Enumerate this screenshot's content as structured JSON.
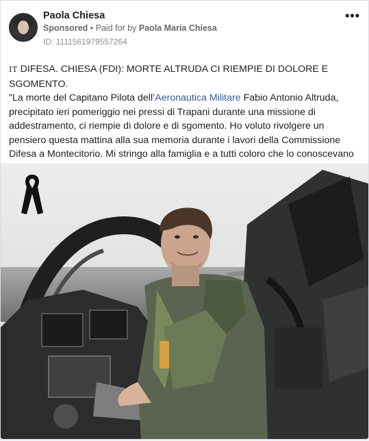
{
  "post": {
    "author": "Paola Chiesa",
    "sponsored_label": "Sponsored",
    "paid_for_prefix": "Paid for by",
    "payer": "Paola Maria Chiesa",
    "ad_id": "ID: 1111561979557264",
    "more_menu": "•••"
  },
  "content": {
    "flag": "IT",
    "headline": "DIFESA. CHIESA (FDI): MORTE ALTRUDA CI RIEMPIE DI DOLORE E SGOMENTO.",
    "body_before_link": "\"La morte del Capitano Pilota dell’",
    "link_text": "Aeronautica Militare",
    "body_after_link": " Fabio Antonio Altruda, precipitato ieri pomeriggio nei pressi di Trapani durante una missione di addestramento, ci riempie di dolore e di sgomento. Ho voluto rivolgere un pensiero questa mattina alla sua memoria durante i lavori della Commissione Difesa a Montecitorio. Mi stringo alla famiglia e a tutti coloro che lo conoscevano e oggi lo piangono. Cieli blu!”. Lo ha detto il capogruppo di Fratelli d’Italia in Commissione…"
  },
  "image": {
    "icons": [
      "mourning-ribbon-icon"
    ],
    "colors": {
      "sky": "#e3e4e4",
      "cockpit": "#3a3b3b",
      "flight_suit": "#5f6f4a"
    }
  }
}
